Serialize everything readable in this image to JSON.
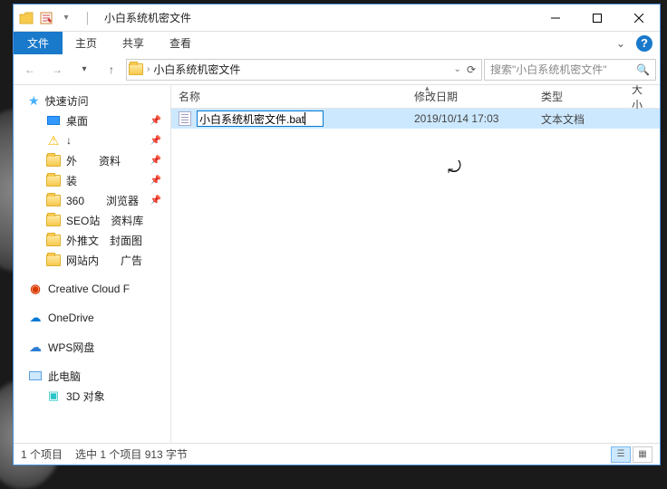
{
  "window": {
    "title": "小白系统机密文件"
  },
  "ribbon": {
    "file": "文件",
    "home": "主页",
    "share": "共享",
    "view": "查看"
  },
  "address": {
    "path": "小白系统机密文件",
    "searchPlaceholder": "搜索\"小白系统机密文件\""
  },
  "nav": {
    "quickAccess": "快速访问",
    "items": [
      "桌面",
      "↓",
      "外　　资料",
      "装　",
      "360　　浏览器",
      "SEO站　资料库",
      "外推文　封面图",
      "网站内　　广告"
    ],
    "cc": "Creative Cloud F",
    "onedrive": "OneDrive",
    "wps": "WPS网盘",
    "thispc": "此电脑",
    "threeD": "3D 对象"
  },
  "columns": {
    "name": "名称",
    "date": "修改日期",
    "type": "类型",
    "size": "大小"
  },
  "files": [
    {
      "name": "小白系统机密文件.bat",
      "date": "2019/10/14 17:03",
      "type": "文本文档"
    }
  ],
  "status": {
    "count": "1 个项目",
    "selection": "选中 1 个项目  913 字节"
  }
}
